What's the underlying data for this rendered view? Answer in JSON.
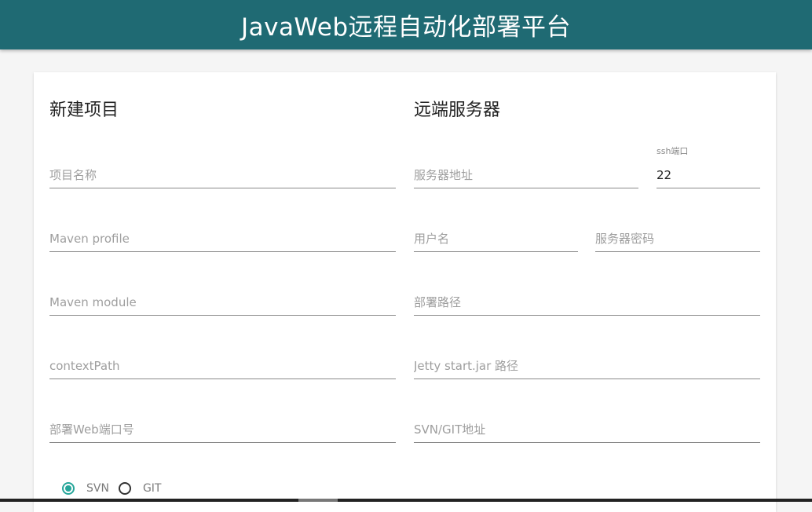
{
  "header": {
    "title": "JavaWeb远程自动化部署平台"
  },
  "left_section": {
    "title": "新建项目",
    "fields": [
      {
        "placeholder": "项目名称",
        "value": ""
      },
      {
        "placeholder": "Maven profile",
        "value": ""
      },
      {
        "placeholder": "Maven module",
        "value": ""
      },
      {
        "placeholder": "contextPath",
        "value": ""
      },
      {
        "placeholder": "部署Web端口号",
        "value": ""
      }
    ],
    "vcs": {
      "options": [
        "SVN",
        "GIT"
      ],
      "selected": "SVN"
    }
  },
  "right_section": {
    "title": "远端服务器",
    "server_address": {
      "placeholder": "服务器地址",
      "value": ""
    },
    "ssh_port": {
      "label": "ssh端口",
      "value": "22"
    },
    "username": {
      "placeholder": "用户名",
      "value": ""
    },
    "password": {
      "placeholder": "服务器密码",
      "value": ""
    },
    "deploy_path": {
      "placeholder": "部署路径",
      "value": ""
    },
    "jetty_path": {
      "placeholder": "Jetty start.jar 路径",
      "value": ""
    },
    "repo_url": {
      "placeholder": "SVN/GIT地址",
      "value": ""
    }
  },
  "colors": {
    "appbar": "#1f6a73",
    "accent": "#26a69a"
  }
}
